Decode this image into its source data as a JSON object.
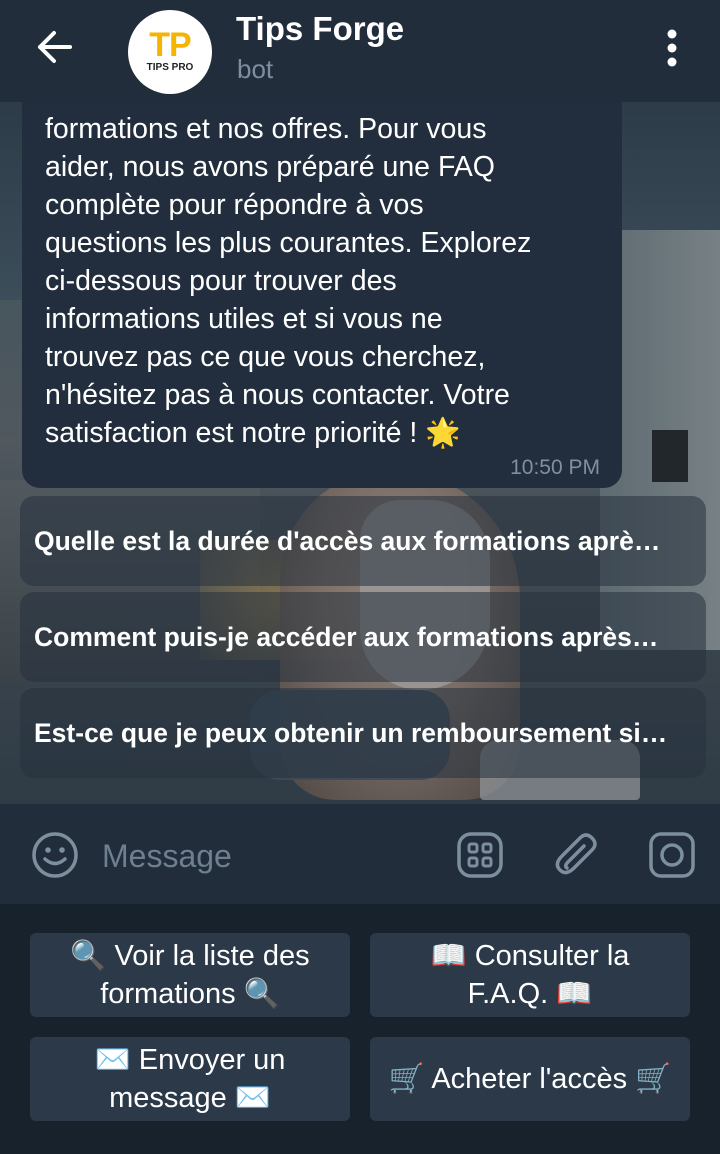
{
  "header": {
    "title": "Tips Forge",
    "status": "bot",
    "avatar_logo": "TP",
    "avatar_sub": "TIPS PRO"
  },
  "message": {
    "text": "formations et nos offres. Pour vous\naider, nous avons préparé une FAQ\ncomplète pour répondre à vos\nquestions les plus courantes. Explorez\nci-dessous pour trouver des\ninformations utiles et si vous ne\ntrouvez pas ce que vous cherchez,\nn'hésitez pas à nous contacter. Votre\nsatisfaction est notre priorité ! 🌟",
    "time": "10:50 PM"
  },
  "inline_buttons": [
    "Quelle est la durée d'accès aux formations aprè…",
    "Comment puis-je accéder aux formations après…",
    "Est-ce que je peux obtenir un remboursement si…"
  ],
  "composer": {
    "placeholder": "Message"
  },
  "reply_keyboard": [
    "🔍 Voir la liste des formations 🔍",
    "📖 Consulter la F.A.Q. 📖",
    "✉️ Envoyer un message ✉️",
    "🛒 Acheter l'accès 🛒"
  ],
  "colors": {
    "header_bg": "#212d3b",
    "bubble_bg": "#222e3d",
    "keyboard_bg": "#18222d",
    "key_bg": "#2b3949",
    "muted_text": "#7d8e9e"
  }
}
